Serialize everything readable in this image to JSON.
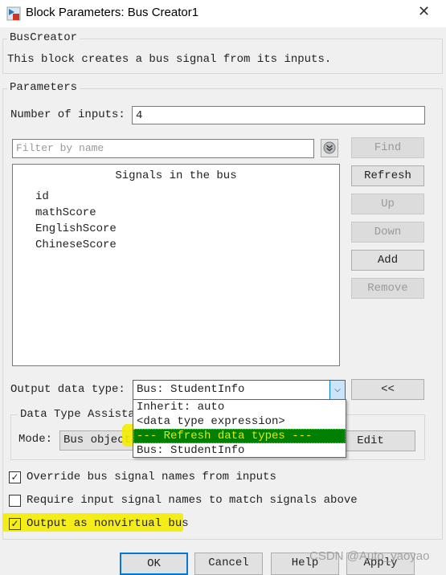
{
  "window": {
    "title": "Block Parameters: Bus Creator1"
  },
  "block": {
    "group_label": "BusCreator",
    "description": "This block creates a bus signal from its inputs."
  },
  "parameters": {
    "group_label": "Parameters",
    "num_inputs_label": "Number of inputs:",
    "num_inputs_value": "4",
    "filter_placeholder": "Filter by name",
    "find_label": "Find",
    "signals_header": "Signals in the bus",
    "signals": [
      "id",
      "mathScore",
      "EnglishScore",
      "ChineseScore"
    ],
    "side_buttons": [
      {
        "label": "Refresh",
        "enabled": true
      },
      {
        "label": "Up",
        "enabled": false
      },
      {
        "label": "Down",
        "enabled": false
      },
      {
        "label": "Add",
        "enabled": true
      },
      {
        "label": "Remove",
        "enabled": false
      }
    ],
    "output_type_label": "Output data type:",
    "output_type_value": "Bus: StudentInfo",
    "collapse_label": "<<",
    "dropdown_options": [
      "Inherit: auto",
      "<data type expression>",
      "--- Refresh data types ---",
      "Bus: StudentInfo"
    ],
    "dropdown_selected_index": 2,
    "assistant_label": "Data Type Assista",
    "mode_label": "Mode:",
    "mode_value": "Bus object",
    "edit_label": "Edit",
    "checkboxes": [
      {
        "label": "Override bus signal names from inputs",
        "checked": true
      },
      {
        "label": "Require input signal names to match signals above",
        "checked": false
      },
      {
        "label": "Output as nonvirtual bus",
        "checked": true
      }
    ]
  },
  "footer": {
    "ok": "OK",
    "cancel": "Cancel",
    "help": "Help",
    "apply": "Apply"
  },
  "watermark": "CSDN @Auto_yaoyao",
  "colors": {
    "highlight": "#f5ec00",
    "selected_bg": "#008000",
    "selected_fg": "#e8e800",
    "focus": "#0078d7"
  }
}
